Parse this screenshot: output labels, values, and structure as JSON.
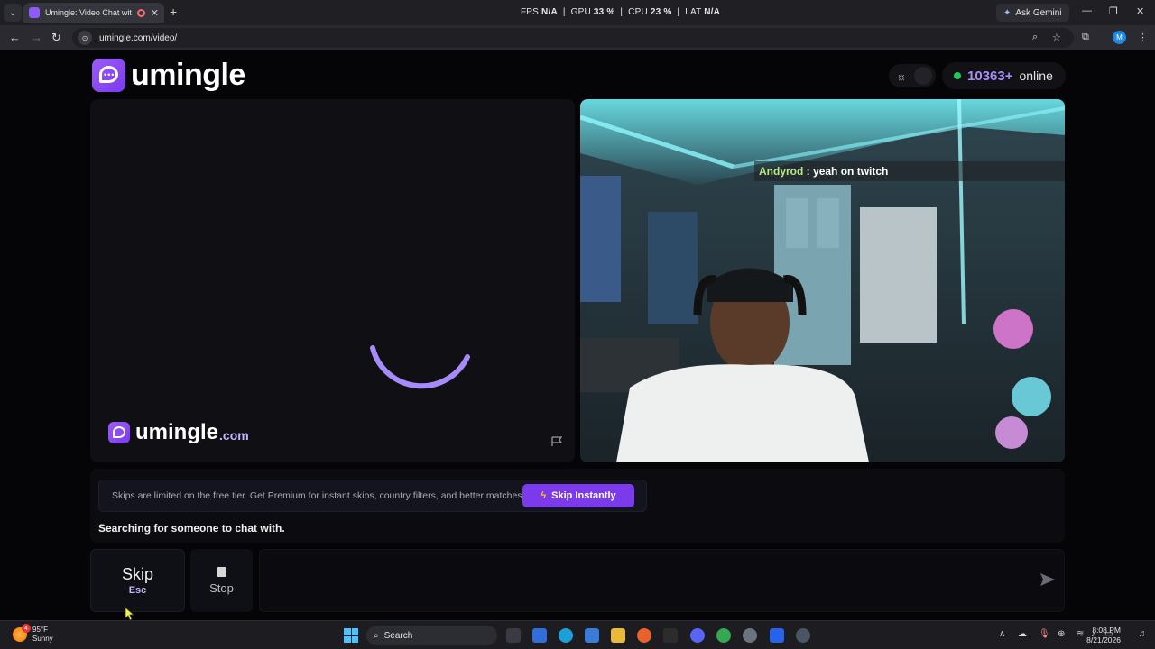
{
  "browser": {
    "tab_title": "Umingle: Video Chat with St",
    "new_tab_symbol": "+",
    "perf": {
      "fps_label": "FPS",
      "fps": "N/A",
      "gpu_label": "GPU",
      "gpu": "33 %",
      "cpu_label": "CPU",
      "cpu": "23 %",
      "lat_label": "LAT",
      "lat": "N/A"
    },
    "gemini_label": "Ask Gemini",
    "url": "umingle.com/video/",
    "profile_initial": "M"
  },
  "header": {
    "logo_text": "umingle",
    "online_count": "10363+",
    "online_label": "online"
  },
  "left_panel": {
    "brand_name": "umingle",
    "brand_tld": ".com"
  },
  "right_panel": {
    "chat_user": "Andyrod",
    "chat_separator": " : ",
    "chat_message": "yeah on twitch"
  },
  "status": {
    "promo_text": "Skips are limited on the free tier. Get Premium for instant skips, country filters, and better matches.",
    "skip_instantly_label": "Skip Instantly",
    "searching_text": "Searching for someone to chat with."
  },
  "controls": {
    "skip_label": "Skip",
    "skip_shortcut": "Esc",
    "stop_label": "Stop",
    "chat_placeholder": ""
  },
  "taskbar": {
    "weather_temp": "95°F",
    "weather_cond": "Sunny",
    "weather_badge": "4",
    "search_label": "Search",
    "time": "8:08 PM",
    "date": "8/21/2026"
  },
  "colors": {
    "accent": "#7c3aed",
    "accent_light": "#a78bfa",
    "online_dot": "#22c55e"
  }
}
